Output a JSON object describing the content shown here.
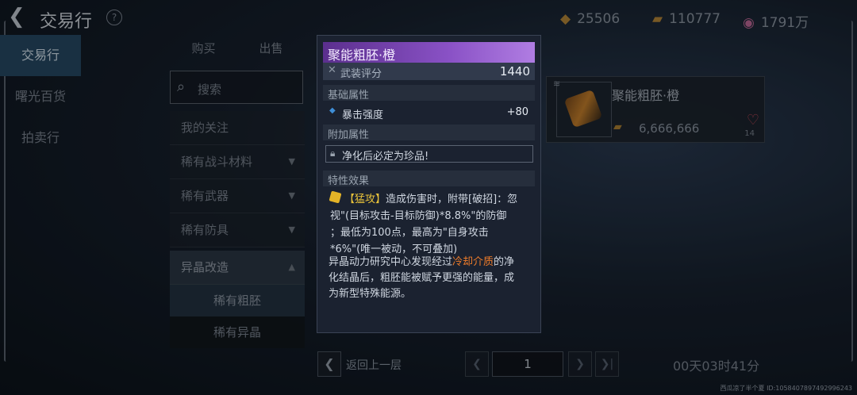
{
  "header": {
    "title": "交易行",
    "help": "?",
    "currencies": [
      {
        "icon": "wing-icon",
        "value": "25506"
      },
      {
        "icon": "gold-bars-icon",
        "value": "110777"
      },
      {
        "icon": "bag-icon",
        "value": "1791万"
      }
    ]
  },
  "sidebar": {
    "items": [
      {
        "label": "交易行",
        "active": true
      },
      {
        "label": "曙光百货",
        "active": false
      },
      {
        "label": "拍卖行",
        "active": false
      }
    ]
  },
  "tabs": [
    "购买",
    "出售"
  ],
  "search": {
    "placeholder": "搜索"
  },
  "categories": [
    {
      "label": "我的关注"
    },
    {
      "label": "稀有战斗材料",
      "arrow": "▼"
    },
    {
      "label": "稀有武器",
      "arrow": "▼"
    },
    {
      "label": "稀有防具",
      "arrow": "▼"
    },
    {
      "label": "异晶改造",
      "arrow": "▲"
    }
  ],
  "subcategories": [
    {
      "label": "稀有粗胚",
      "selected": true
    },
    {
      "label": "稀有异晶",
      "selected": false
    }
  ],
  "listing": {
    "name": "聚能粗胚·橙",
    "price": "6,666,666",
    "likes": "14"
  },
  "pager": {
    "prev_label": "返回上一层",
    "page": "1",
    "timer": "00天03时41分"
  },
  "tooltip": {
    "name": "聚能粗胚·橙",
    "score_label": "武装评分",
    "score_value": "1440",
    "base_section": "基础属性",
    "stat_label": "暴击强度",
    "stat_value": "+80",
    "extra_section": "附加属性",
    "lock_text": "净化后必定为珍品!",
    "effect_section": "特性效果",
    "skill_keyword": "【猛攻】",
    "skill_line1": "造成伤害时，附带[破招]：忽",
    "skill_line2": "视\"(目标攻击-目标防御)*8.8%\"的防御",
    "skill_line3": "；最低为100点，最高为\"自身攻击",
    "skill_line4": "*6%\"(唯一被动，不可叠加)",
    "desc_before": "异晶动力研究中心发现经过",
    "desc_highlight": "冷却介质",
    "desc_after1": "的净",
    "desc_line2": "化结晶后，粗胚能被赋予更强的能量，成",
    "desc_line3": "为新型特殊能源。"
  },
  "watermark": "西瓜凉了半个夏  ID:1058407897492996243",
  "colors": {
    "rarity_orange_header": "#8a52c6",
    "highlight": "#ef7c2a",
    "keyword": "#e8c23a"
  }
}
